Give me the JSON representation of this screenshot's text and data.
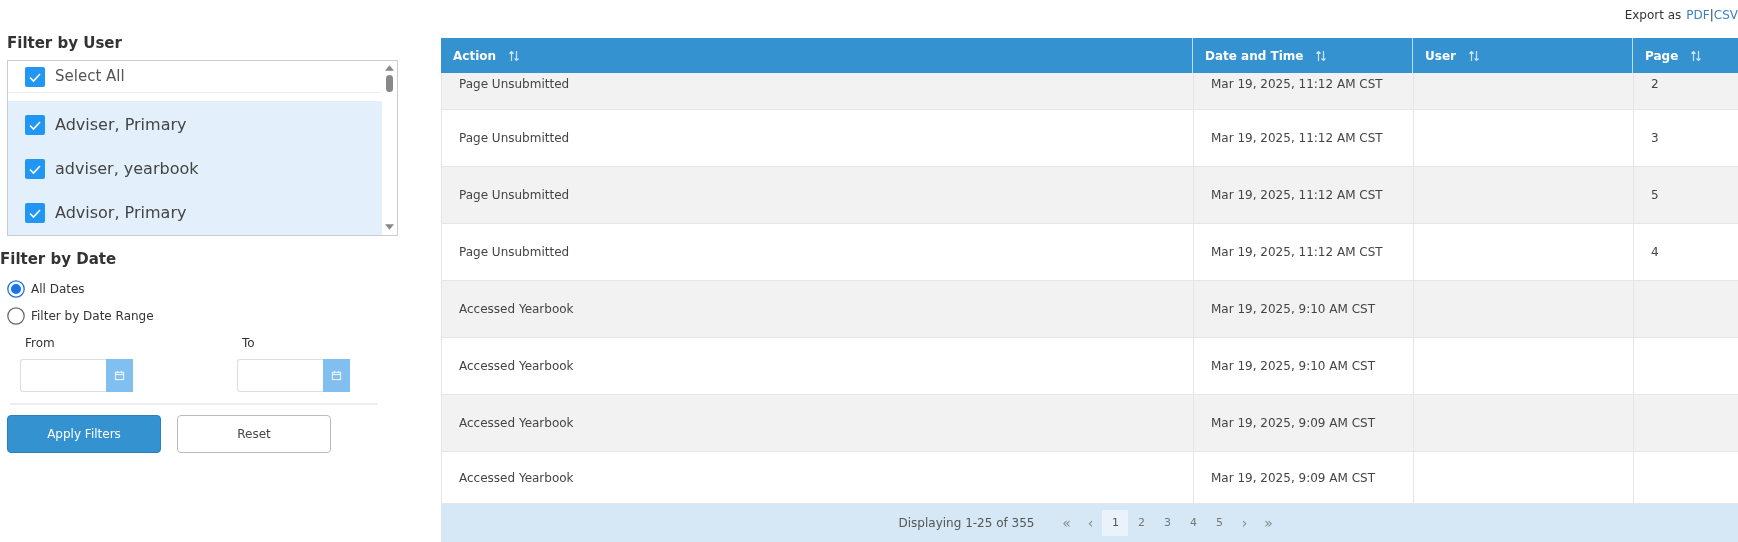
{
  "export": {
    "label": "Export as",
    "links": [
      "PDF",
      "CSV"
    ],
    "separator": "|"
  },
  "user_filter": {
    "title": "Filter by User",
    "select_all": {
      "label": "Select All",
      "checked": true
    },
    "users": [
      {
        "label": "Adviser, Primary",
        "checked": true
      },
      {
        "label": "adviser, yearbook",
        "checked": true
      },
      {
        "label": "Advisor, Primary",
        "checked": true
      }
    ]
  },
  "date_filter": {
    "title": "Filter by Date",
    "options": [
      {
        "label": "All Dates",
        "selected": true
      },
      {
        "label": "Filter by Date Range",
        "selected": false
      }
    ],
    "fields": [
      {
        "label": "From"
      },
      {
        "label": "To"
      }
    ]
  },
  "buttons": [
    {
      "label": "Apply Filters",
      "kind": "primary"
    },
    {
      "label": "Reset",
      "kind": "secondary"
    }
  ],
  "table": {
    "columns": [
      "Action",
      "Date and Time",
      "User",
      "Page"
    ],
    "rows": [
      {
        "action": "Page Unsubmitted",
        "date": "Mar 19, 2025, 11:12 AM CST",
        "page": "2"
      },
      {
        "action": "Page Unsubmitted",
        "date": "Mar 19, 2025, 11:12 AM CST",
        "page": "3"
      },
      {
        "action": "Page Unsubmitted",
        "date": "Mar 19, 2025, 11:12 AM CST",
        "page": "5"
      },
      {
        "action": "Page Unsubmitted",
        "date": "Mar 19, 2025, 11:12 AM CST",
        "page": "4"
      },
      {
        "action": "Accessed Yearbook",
        "date": "Mar 19, 2025, 9:10 AM CST"
      },
      {
        "action": "Accessed Yearbook",
        "date": "Mar 19, 2025, 9:10 AM CST"
      },
      {
        "action": "Accessed Yearbook",
        "date": "Mar 19, 2025, 9:09 AM CST"
      },
      {
        "action": "Accessed Yearbook",
        "date": "Mar 19, 2025, 9:09 AM CST"
      }
    ]
  },
  "pagination": {
    "summary": "Displaying 1-25 of 355",
    "controls": [
      {
        "label": "«",
        "kind": "nav"
      },
      {
        "label": "‹",
        "kind": "nav"
      },
      {
        "label": "1",
        "kind": "page",
        "selected": true
      },
      {
        "label": "2",
        "kind": "page",
        "selected": false
      },
      {
        "label": "3",
        "kind": "page",
        "selected": false
      },
      {
        "label": "4",
        "kind": "page",
        "selected": false
      },
      {
        "label": "5",
        "kind": "page",
        "selected": false
      },
      {
        "label": "›",
        "kind": "nav"
      },
      {
        "label": "»",
        "kind": "nav"
      }
    ]
  }
}
